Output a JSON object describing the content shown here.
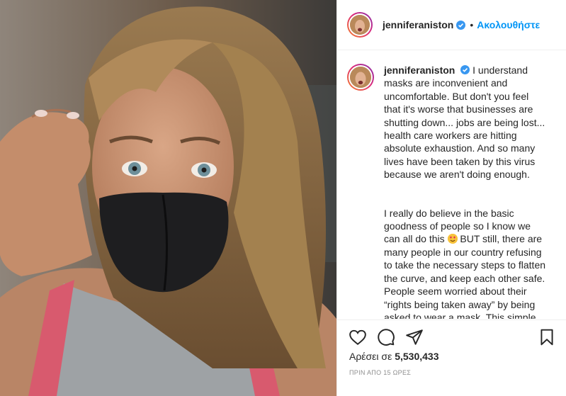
{
  "post": {
    "username": "jenniferaniston",
    "verified": true,
    "dot": "•",
    "follow_label": "Ακολουθήστε",
    "caption": {
      "username": "jenniferaniston",
      "paragraph1": "I understand masks are inconvenient and uncomfortable. But don't you feel that it's worse that businesses are shutting down... jobs are being lost... health care workers are hitting absolute exhaustion. And so many lives have been taken by this virus because we aren't doing enough.",
      "paragraph2_before_emoji": "I really do believe in the basic goodness of people so I know we can all do this",
      "paragraph2_after_emoji": "BUT still, there are many people in our country refusing to take the necessary steps to flatten the curve, and keep each other safe. People seem worried about their “rights being taken away” by being asked to wear a mask. This simple and effective recommendation is being"
    },
    "actions": {
      "like_icon": "heart-icon",
      "comment_icon": "comment-bubble-icon",
      "share_icon": "paper-plane-icon",
      "save_icon": "bookmark-icon"
    },
    "likes_prefix": "Αρέσει σε",
    "likes_count": "5,530,433",
    "timestamp": "ΠΡΙΝ ΑΠΟ 15 ΩΡΕΣ"
  },
  "colors": {
    "follow_blue": "#0095f6",
    "verified_blue": "#3897f0",
    "text": "#262626",
    "muted": "#8e8e8e",
    "border": "#efefef"
  }
}
